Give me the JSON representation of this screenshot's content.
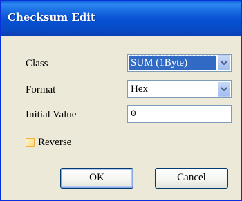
{
  "window": {
    "title": "Checksum Edit"
  },
  "form": {
    "class_label": "Class",
    "class_value": "SUM (1Byte)",
    "format_label": "Format",
    "format_value": "Hex",
    "initial_value_label": "Initial Value",
    "initial_value": "0",
    "reverse_label": "Reverse",
    "reverse_checked": false
  },
  "buttons": {
    "ok_label": "OK",
    "cancel_label": "Cancel"
  },
  "icons": {
    "dropdown": "chevron-down-icon"
  },
  "colors": {
    "titlebar": "#0a49c4",
    "window_bg": "#ece9d8",
    "selection": "#316ac5",
    "checkbox_border": "#f0b23c"
  }
}
